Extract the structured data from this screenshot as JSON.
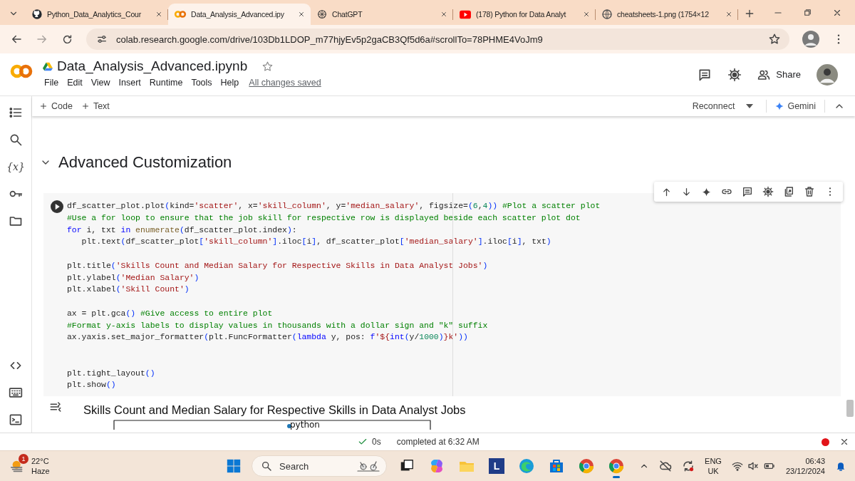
{
  "browser": {
    "tabs": [
      {
        "title": "Python_Data_Analytics_Cour",
        "kind": "repo",
        "selected": false
      },
      {
        "title": "Data_Analysis_Advanced.ipy",
        "kind": "notebook",
        "selected": true
      },
      {
        "title": "ChatGPT",
        "kind": "chat",
        "selected": false
      },
      {
        "title": "(178) Python for Data Analyt",
        "kind": "video",
        "selected": false
      },
      {
        "title": "cheatsheets-1.png (1754×12",
        "kind": "web",
        "selected": false
      }
    ],
    "address": "colab.research.google.com/drive/103Db1LDOP_m77hjyEv5p2gaCB3Qf5d6a#scrollTo=78PHME4VoJm9",
    "bookmarked": false
  },
  "header": {
    "file_name": "Data_Analysis_Advanced.ipynb",
    "starred": false,
    "menus": [
      "File",
      "Edit",
      "View",
      "Insert",
      "Runtime",
      "Tools",
      "Help"
    ],
    "save_status": "All changes saved",
    "share": "Share"
  },
  "toolbar": {
    "add_buttons": [
      "Code",
      "Text"
    ],
    "runtime_button": "Reconnect",
    "assistant": "Gemini"
  },
  "sidebar": {
    "variables_icon_text": "{x}"
  },
  "section": {
    "title": "Advanced Customization",
    "expanded": true
  },
  "cell": {
    "lines": [
      {
        "kind": "code",
        "tokens": [
          {
            "text": "df_scatter_plot.plot",
            "kind": "plain"
          },
          {
            "text": "(",
            "kind": "bracket"
          },
          {
            "text": "kind=",
            "kind": "plain"
          },
          {
            "text": "'scatter'",
            "kind": "string"
          },
          {
            "text": ", x=",
            "kind": "plain"
          },
          {
            "text": "'skill_column'",
            "kind": "string"
          },
          {
            "text": ", y=",
            "kind": "plain"
          },
          {
            "text": "'median_salary'",
            "kind": "string"
          },
          {
            "text": ", figsize=",
            "kind": "plain"
          },
          {
            "text": "(",
            "kind": "bracket"
          },
          {
            "text": "6",
            "kind": "number"
          },
          {
            "text": ",",
            "kind": "plain"
          },
          {
            "text": "4",
            "kind": "number"
          },
          {
            "text": "))",
            "kind": "bracket"
          },
          {
            "text": " #Plot a scatter plot",
            "kind": "comment"
          }
        ]
      },
      {
        "kind": "code",
        "tokens": [
          {
            "text": "#Use a for loop to ensure that the job skill for respective row is displayed beside each scatter plot dot",
            "kind": "comment"
          }
        ]
      },
      {
        "kind": "code",
        "tokens": [
          {
            "text": "for",
            "kind": "keyword"
          },
          {
            "text": " i, txt ",
            "kind": "plain"
          },
          {
            "text": "in",
            "kind": "keyword"
          },
          {
            "text": " enumerate",
            "kind": "builtin"
          },
          {
            "text": "(",
            "kind": "bracket"
          },
          {
            "text": "df_scatter_plot.index",
            "kind": "plain"
          },
          {
            "text": ")",
            "kind": "bracket"
          },
          {
            "text": ":",
            "kind": "plain"
          }
        ]
      },
      {
        "kind": "code",
        "tokens": [
          {
            "text": "   plt.text",
            "kind": "plain"
          },
          {
            "text": "(",
            "kind": "bracket"
          },
          {
            "text": "df_scatter_plot",
            "kind": "plain"
          },
          {
            "text": "[",
            "kind": "bracket"
          },
          {
            "text": "'skill_column'",
            "kind": "string"
          },
          {
            "text": "]",
            "kind": "bracket"
          },
          {
            "text": ".iloc",
            "kind": "plain"
          },
          {
            "text": "[",
            "kind": "bracket"
          },
          {
            "text": "i",
            "kind": "plain"
          },
          {
            "text": "]",
            "kind": "bracket"
          },
          {
            "text": ", df_scatter_plot",
            "kind": "plain"
          },
          {
            "text": "[",
            "kind": "bracket"
          },
          {
            "text": "'median_salary'",
            "kind": "string"
          },
          {
            "text": "]",
            "kind": "bracket"
          },
          {
            "text": ".iloc",
            "kind": "plain"
          },
          {
            "text": "[",
            "kind": "bracket"
          },
          {
            "text": "i",
            "kind": "plain"
          },
          {
            "text": "]",
            "kind": "bracket"
          },
          {
            "text": ", txt",
            "kind": "plain"
          },
          {
            "text": ")",
            "kind": "bracket"
          }
        ]
      },
      {
        "kind": "blank"
      },
      {
        "kind": "code",
        "tokens": [
          {
            "text": "plt.title",
            "kind": "plain"
          },
          {
            "text": "(",
            "kind": "bracket"
          },
          {
            "text": "'Skills Count and Median Salary for Respective Skills in Data Analyst Jobs'",
            "kind": "string"
          },
          {
            "text": ")",
            "kind": "bracket"
          }
        ]
      },
      {
        "kind": "code",
        "tokens": [
          {
            "text": "plt.ylabel",
            "kind": "plain"
          },
          {
            "text": "(",
            "kind": "bracket"
          },
          {
            "text": "'Median Salary'",
            "kind": "string"
          },
          {
            "text": ")",
            "kind": "bracket"
          }
        ]
      },
      {
        "kind": "code",
        "tokens": [
          {
            "text": "plt.xlabel",
            "kind": "plain"
          },
          {
            "text": "(",
            "kind": "bracket"
          },
          {
            "text": "'Skill Count'",
            "kind": "string"
          },
          {
            "text": ")",
            "kind": "bracket"
          }
        ]
      },
      {
        "kind": "blank"
      },
      {
        "kind": "code",
        "tokens": [
          {
            "text": "ax = plt.gca",
            "kind": "plain"
          },
          {
            "text": "()",
            "kind": "bracket"
          },
          {
            "text": " #Give access to entire plot",
            "kind": "comment"
          }
        ]
      },
      {
        "kind": "code",
        "tokens": [
          {
            "text": "#Format y-axis labels to display values in thousands with a dollar sign and \"k\" suffix",
            "kind": "comment"
          }
        ]
      },
      {
        "kind": "code",
        "tokens": [
          {
            "text": "ax.yaxis.set_major_formatter",
            "kind": "plain"
          },
          {
            "text": "(",
            "kind": "bracket"
          },
          {
            "text": "plt.FuncFormatter",
            "kind": "plain"
          },
          {
            "text": "(",
            "kind": "bracket"
          },
          {
            "text": "lambda",
            "kind": "keyword"
          },
          {
            "text": " y, pos: ",
            "kind": "plain"
          },
          {
            "text": "f",
            "kind": "keyword"
          },
          {
            "text": "'${",
            "kind": "string"
          },
          {
            "text": "int",
            "kind": "keyword"
          },
          {
            "text": "(",
            "kind": "bracket"
          },
          {
            "text": "y/",
            "kind": "plain"
          },
          {
            "text": "1000",
            "kind": "number"
          },
          {
            "text": ")",
            "kind": "bracket"
          },
          {
            "text": "}k'",
            "kind": "string"
          },
          {
            "text": "))",
            "kind": "bracket"
          }
        ]
      },
      {
        "kind": "blank"
      },
      {
        "kind": "blank"
      },
      {
        "kind": "code",
        "tokens": [
          {
            "text": "plt.tight_layout",
            "kind": "plain"
          },
          {
            "text": "()",
            "kind": "bracket"
          }
        ]
      },
      {
        "kind": "code",
        "tokens": [
          {
            "text": "plt.show",
            "kind": "plain"
          },
          {
            "text": "()",
            "kind": "bracket"
          }
        ]
      }
    ]
  },
  "output": {
    "chart_title": "Skills Count and Median Salary for Respective Skills in Data Analyst Jobs",
    "point_label": "python"
  },
  "status": {
    "elapsed": "0s",
    "message": "completed at 6:32 AM"
  },
  "taskbar": {
    "weather": {
      "badge": "1",
      "temperature": "22°C",
      "condition": "Haze"
    },
    "search": "Search",
    "apps": [
      {
        "kind": "taskview",
        "running": false
      },
      {
        "kind": "copilot",
        "running": false
      },
      {
        "kind": "folder",
        "running": false
      },
      {
        "kind": "tile",
        "text": "L",
        "running": false
      },
      {
        "kind": "edge",
        "running": false
      },
      {
        "kind": "store",
        "running": false
      },
      {
        "kind": "chrome",
        "running": false
      },
      {
        "kind": "chrome",
        "running": true
      }
    ],
    "language": "ENG",
    "region": "UK",
    "time": "06:43",
    "date": "23/12/2024"
  }
}
